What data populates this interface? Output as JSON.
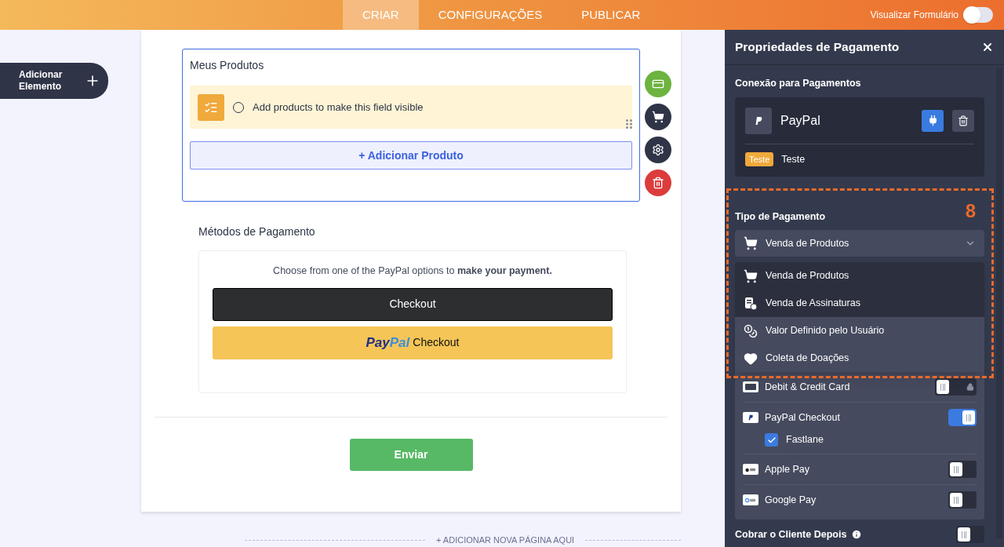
{
  "top_bar": {
    "tabs": [
      {
        "label": "CRIAR",
        "selected": true
      },
      {
        "label": "CONFIGURAÇÕES",
        "selected": false
      },
      {
        "label": "PUBLICAR",
        "selected": false
      }
    ],
    "preview": {
      "label": "Visualizar Formulário",
      "on": false
    }
  },
  "add_element": "Adicionar Elemento",
  "form": {
    "product_field": {
      "title": "Meus Produtos",
      "notice": "Add products to make this field visible",
      "add_button": "+ Adicionar Produto"
    },
    "field_actions": [
      {
        "kind": "card",
        "color": "#6cb33f"
      },
      {
        "kind": "cart",
        "color": "#2f3447"
      },
      {
        "kind": "settings",
        "color": "#2f3447"
      },
      {
        "kind": "delete",
        "color": "#dc3c3c"
      }
    ],
    "payment_methods": {
      "title": "Métodos de Pagamento",
      "prompt": "Choose from one of the PayPal options to **make your payment.**",
      "checkout_button": "Checkout",
      "paypal_button": {
        "brand_pay": "Pay",
        "brand_pal": "Pal",
        "label": "Checkout"
      }
    },
    "submit": "Enviar",
    "add_page": "+ ADICIONAR NOVA PÁGINA AQUI"
  },
  "panel": {
    "title": "Propriedades de Pagamento",
    "connection_label": "Conexão para Pagamentos",
    "gateway": {
      "name": "PayPal",
      "badge": "Teste",
      "mode": "Teste"
    },
    "annotation": "8",
    "payment_type": {
      "label": "Tipo de Pagamento",
      "value": "Venda de Produtos",
      "options": [
        {
          "kind": "cart",
          "label": "Venda de Produtos",
          "highlighted": true
        },
        {
          "kind": "subscription",
          "label": "Venda de Assinaturas",
          "highlighted": true
        },
        {
          "kind": "coins",
          "label": "Valor Definido pelo Usuário",
          "highlighted": false
        },
        {
          "kind": "heart",
          "label": "Coleta de Doações",
          "highlighted": false
        }
      ]
    },
    "methods": [
      {
        "kind": "card",
        "label": "Debit & Credit Card",
        "on": false,
        "locked": true
      },
      {
        "kind": "paypal",
        "label": "PayPal Checkout",
        "on": true,
        "locked": false,
        "option": {
          "label": "Fastlane",
          "checked": true
        }
      },
      {
        "kind": "apple",
        "label": "Apple Pay",
        "on": false,
        "locked": false
      },
      {
        "kind": "google",
        "label": "Google Pay",
        "on": false,
        "locked": false
      }
    ],
    "charge_later": {
      "label": "Cobrar o Cliente Depois",
      "on": false
    }
  }
}
